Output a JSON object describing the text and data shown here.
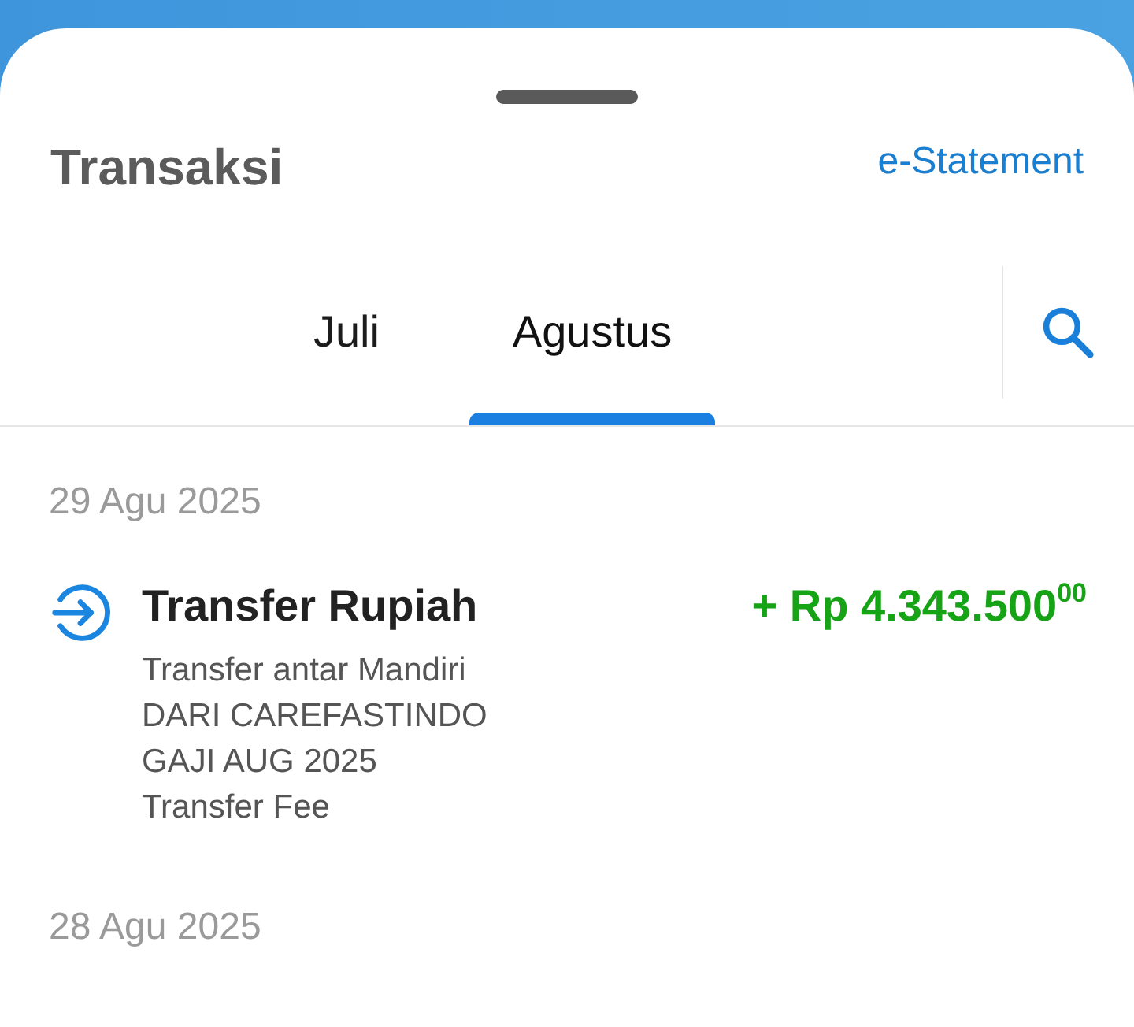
{
  "header": {
    "title": "Transaksi",
    "link": "e-Statement"
  },
  "tabs": [
    {
      "label": "Juli",
      "selected": false
    },
    {
      "label": "Agustus",
      "selected": true
    }
  ],
  "groups": [
    {
      "date": "29 Agu 2025",
      "transactions": [
        {
          "kind": "credit",
          "title": "Transfer Rupiah",
          "amount": "+ Rp 4.343.500$^{00}$",
          "details": [
            "Transfer antar Mandiri",
            "DARI CAREFASTINDO",
            "GAJI AUG 2025",
            "Transfer Fee"
          ]
        }
      ]
    },
    {
      "date": "28 Agu 2025"
    }
  ]
}
